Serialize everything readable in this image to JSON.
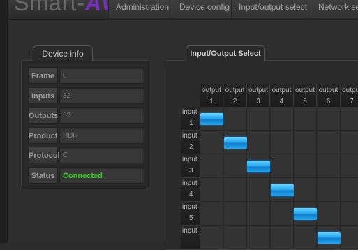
{
  "brand": {
    "name_left": "Smart-",
    "name_accent": "AVI"
  },
  "nav": {
    "tabs": [
      "Administration",
      "Device config",
      "Input/output select",
      "Network se"
    ]
  },
  "device_info": {
    "title": "Device info",
    "rows": [
      {
        "label": "Frame",
        "value": "0"
      },
      {
        "label": "Inputs",
        "value": "32"
      },
      {
        "label": "Outputs",
        "value": "32"
      },
      {
        "label": "Product",
        "value": "HDR"
      },
      {
        "label": "Protocol",
        "value": "C"
      },
      {
        "label": "Status",
        "value": "Connected"
      }
    ],
    "status_color": "#33d21e"
  },
  "io_select": {
    "title": "Input/Output Select",
    "column_label": "output",
    "row_label": "input",
    "columns": [
      "1",
      "2",
      "3",
      "4",
      "5",
      "6",
      "7"
    ],
    "rows": [
      "1",
      "2",
      "3",
      "4",
      "5",
      ""
    ],
    "selected": [
      [
        1,
        1
      ],
      [
        2,
        2
      ],
      [
        3,
        3
      ],
      [
        4,
        4
      ],
      [
        5,
        5
      ],
      [
        6,
        6
      ]
    ],
    "selected_color": "#29a6ec"
  }
}
